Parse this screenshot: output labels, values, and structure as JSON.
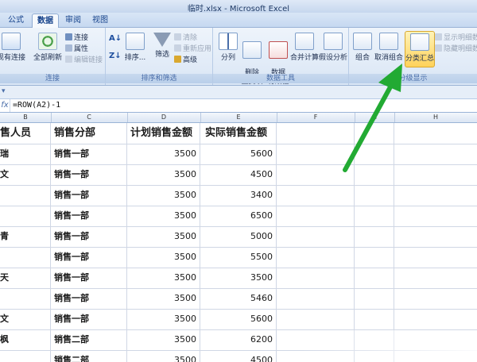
{
  "window": {
    "title": "临时.xlsx - Microsoft Excel"
  },
  "tabs": [
    {
      "label": "公式"
    },
    {
      "label": "数据"
    },
    {
      "label": "审阅"
    },
    {
      "label": "视图"
    }
  ],
  "ribbon": {
    "groups": {
      "connections": {
        "label": "连接",
        "existing": "现有连接",
        "refresh_all": "全部刷新",
        "connections": "连接",
        "properties": "属性",
        "edit_links": "编辑链接"
      },
      "sort_filter": {
        "label": "排序和筛选",
        "sort": "排序...",
        "filter": "筛选",
        "clear": "清除",
        "reapply": "重新应用",
        "advanced": "高级"
      },
      "data_tools": {
        "label": "数据工具",
        "split": "分列",
        "remove_dup": "删除\n重复项",
        "validation": "数据\n有效性",
        "consolidate": "合并计算",
        "whatif": "假设分析"
      },
      "outline": {
        "label": "分级显示",
        "group": "组合",
        "ungroup": "取消组合",
        "subtotal": "分类汇总",
        "show_detail": "显示明细数据",
        "hide_detail": "隐藏明细数据"
      }
    }
  },
  "formula_bar": {
    "fx": "fx",
    "formula": "=ROW(A2)-1"
  },
  "columns": [
    "B",
    "C",
    "D",
    "E",
    "F",
    "G",
    "H"
  ],
  "table": {
    "headers": [
      "售人员",
      "销售分部",
      "计划销售金额",
      "实际销售金额"
    ],
    "rows": [
      {
        "name": "瑞",
        "dept": "销售一部",
        "plan": "3500",
        "actual": "5600"
      },
      {
        "name": "文",
        "dept": "销售一部",
        "plan": "3500",
        "actual": "4500"
      },
      {
        "name": "",
        "dept": "销售一部",
        "plan": "3500",
        "actual": "3400"
      },
      {
        "name": "",
        "dept": "销售一部",
        "plan": "3500",
        "actual": "6500"
      },
      {
        "name": "青",
        "dept": "销售一部",
        "plan": "3500",
        "actual": "5000"
      },
      {
        "name": "",
        "dept": "销售一部",
        "plan": "3500",
        "actual": "5500"
      },
      {
        "name": "天",
        "dept": "销售一部",
        "plan": "3500",
        "actual": "3500"
      },
      {
        "name": "",
        "dept": "销售一部",
        "plan": "3500",
        "actual": "5460"
      },
      {
        "name": "文",
        "dept": "销售一部",
        "plan": "3500",
        "actual": "5600"
      },
      {
        "name": "枫",
        "dept": "销售二部",
        "plan": "3500",
        "actual": "6200"
      },
      {
        "name": "",
        "dept": "销售二部",
        "plan": "3500",
        "actual": "4500"
      }
    ]
  },
  "colors": {
    "arrow": "#22aa33",
    "accent": "#15428b"
  }
}
